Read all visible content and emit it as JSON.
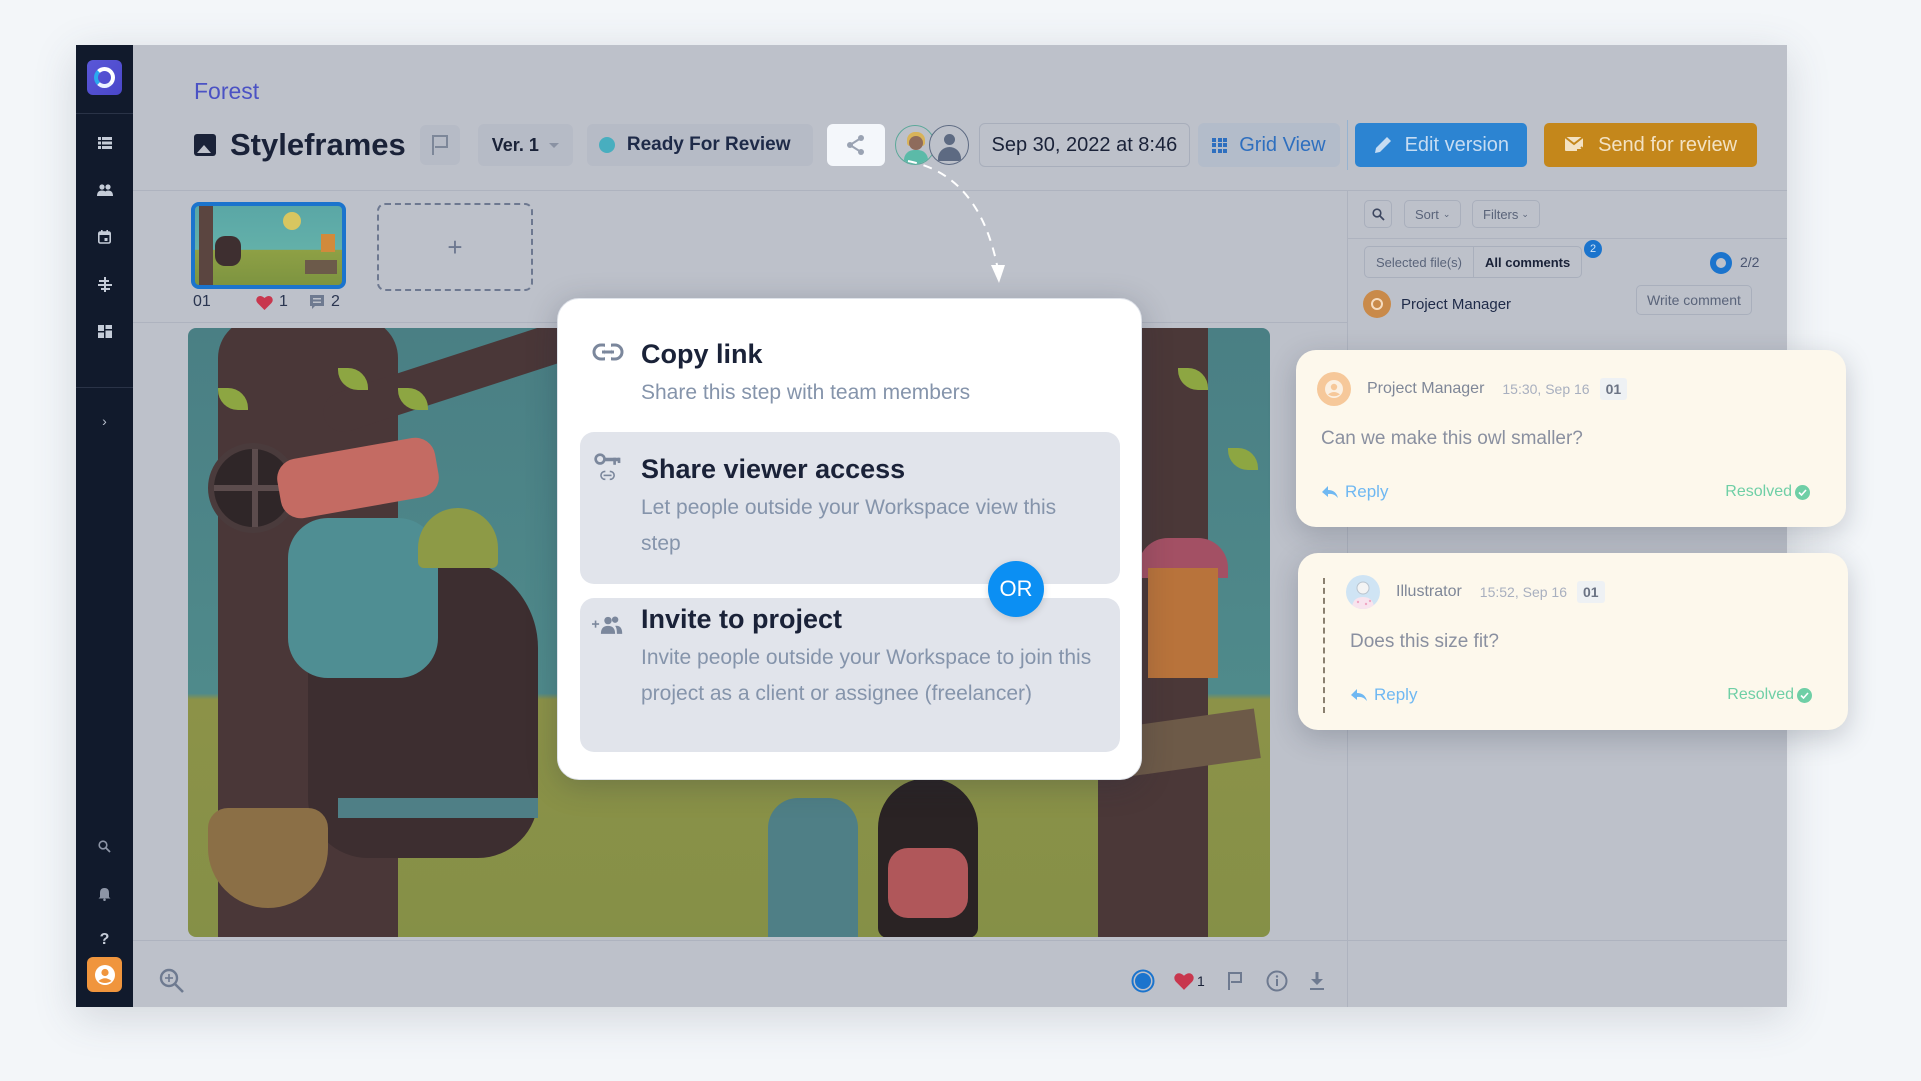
{
  "app": {
    "breadcrumb": "Forest",
    "title": "Styleframes",
    "version_label": "Ver. 1",
    "status": {
      "label": "Ready For Review",
      "color": "#48aebf"
    },
    "date": "Sep 30, 2022 at 8:46",
    "grid_view_label": "Grid View",
    "edit_version_label": "Edit version",
    "send_for_review_label": "Send for review",
    "colors": {
      "accent_blue": "#2c84d2",
      "accent_orange": "#c4871b",
      "brand": "#4b52c4"
    }
  },
  "sidebar": {
    "items": [
      {
        "icon": "list-icon"
      },
      {
        "icon": "team-icon"
      },
      {
        "icon": "calendar-icon"
      },
      {
        "icon": "timeline-icon"
      },
      {
        "icon": "dashboard-icon"
      },
      {
        "icon": "expand-chevron-icon",
        "label": "›"
      }
    ],
    "bottom": [
      {
        "icon": "search-icon"
      },
      {
        "icon": "bell-icon"
      },
      {
        "icon": "help-icon",
        "label": "?"
      },
      {
        "icon": "profile-icon"
      }
    ]
  },
  "thumbnails": [
    {
      "index": "01",
      "likes": "1",
      "comments": "2",
      "selected": true
    }
  ],
  "add_thumbnail_label": "+",
  "share_menu": {
    "options": [
      {
        "title": "Copy link",
        "description": "Share this step with team members",
        "icon": "link-icon"
      },
      {
        "title": "Share viewer access",
        "description": "Let people outside your Workspace view this step",
        "icon": "key-link-icon"
      },
      {
        "title": "Invite to project",
        "description": "Invite people outside your Workspace to join this project as a client or assignee (freelancer)",
        "icon": "add-people-icon"
      }
    ],
    "separator_label": "OR"
  },
  "bottom_bar": {
    "likes": "1"
  },
  "comments_panel": {
    "sort_label": "Sort",
    "filters_label": "Filters",
    "tabs": [
      "Selected file(s)",
      "All comments"
    ],
    "active_tab": "All comments",
    "badge_count": "2",
    "progress": "2/2",
    "current_user": "Project Manager",
    "write_comment_label": "Write comment",
    "comments": [
      {
        "author": "Project Manager",
        "time": "15:30, Sep 16",
        "file": "01",
        "text": "Can we make this owl smaller?",
        "reply_label": "Reply",
        "status": "Resolved"
      },
      {
        "author": "Illustrator",
        "time": "15:52, Sep 16",
        "file": "01",
        "text": "Does this size fit?",
        "reply_label": "Reply",
        "status": "Resolved"
      }
    ]
  }
}
